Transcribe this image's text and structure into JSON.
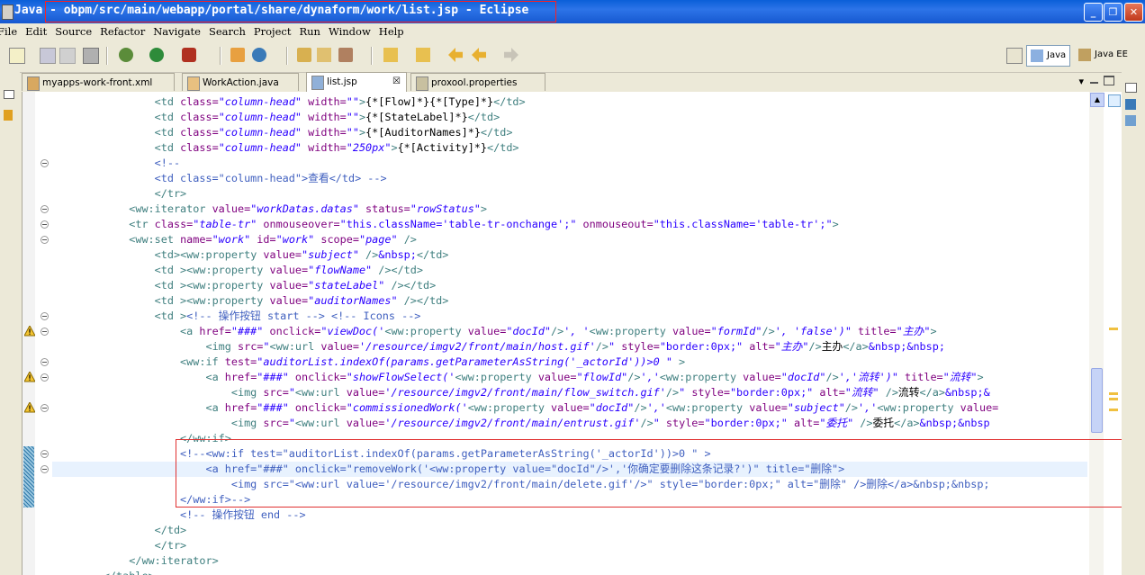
{
  "window": {
    "perspective_label": "Java",
    "title": "- obpm/src/main/webapp/portal/share/dynaform/work/list.jsp - Eclipse",
    "minimize": "_",
    "maximize": "❐",
    "close": "✕"
  },
  "menu": [
    "File",
    "Edit",
    "Source",
    "Refactor",
    "Navigate",
    "Search",
    "Project",
    "Run",
    "Window",
    "Help"
  ],
  "perspectives": [
    {
      "label": "Java",
      "active": true
    },
    {
      "label": "Java EE",
      "active": false
    }
  ],
  "tabs": [
    {
      "label": "myapps-work-front.xml",
      "icon": "xml-file-icon"
    },
    {
      "label": "WorkAction.java",
      "icon": "java-file-icon"
    },
    {
      "label": "list.jsp",
      "icon": "jsp-file-icon",
      "active": true,
      "close": "☒"
    },
    {
      "label": "proxool.properties",
      "icon": "properties-file-icon"
    }
  ],
  "code_lines": [
    [
      [
        "                ",
        ""
      ],
      [
        "<td ",
        "tag"
      ],
      [
        "class=",
        "attr"
      ],
      [
        "\"column-head\"",
        "str"
      ],
      [
        " width=",
        "attr"
      ],
      [
        "\"\"",
        "str"
      ],
      [
        ">",
        "tag"
      ],
      [
        "{*[Flow]*}{*[Type]*}",
        "txt"
      ],
      [
        "</td>",
        "tag"
      ]
    ],
    [
      [
        "                ",
        ""
      ],
      [
        "<td ",
        "tag"
      ],
      [
        "class=",
        "attr"
      ],
      [
        "\"column-head\"",
        "str"
      ],
      [
        " width=",
        "attr"
      ],
      [
        "\"\"",
        "str"
      ],
      [
        ">",
        "tag"
      ],
      [
        "{*[StateLabel]*}",
        "txt"
      ],
      [
        "</td>",
        "tag"
      ]
    ],
    [
      [
        "                ",
        ""
      ],
      [
        "<td ",
        "tag"
      ],
      [
        "class=",
        "attr"
      ],
      [
        "\"column-head\"",
        "str"
      ],
      [
        " width=",
        "attr"
      ],
      [
        "\"\"",
        "str"
      ],
      [
        ">",
        "tag"
      ],
      [
        "{*[AuditorNames]*}",
        "txt"
      ],
      [
        "</td>",
        "tag"
      ]
    ],
    [
      [
        "                ",
        ""
      ],
      [
        "<td ",
        "tag"
      ],
      [
        "class=",
        "attr"
      ],
      [
        "\"column-head\"",
        "str"
      ],
      [
        " width=",
        "attr"
      ],
      [
        "\"250px\"",
        "str"
      ],
      [
        ">",
        "tag"
      ],
      [
        "{*[Activity]*}",
        "txt"
      ],
      [
        "</td>",
        "tag"
      ]
    ],
    [
      [
        "                ",
        ""
      ],
      [
        "<!--",
        "cmt"
      ]
    ],
    [
      [
        "                ",
        ""
      ],
      [
        "<td class=\"column-head\">查看</td> -->",
        "cmt"
      ]
    ],
    [
      [
        "                ",
        ""
      ],
      [
        "</tr>",
        "tag"
      ]
    ],
    [
      [
        "            ",
        ""
      ],
      [
        "<ww:iterator ",
        "tag"
      ],
      [
        "value=",
        "attr"
      ],
      [
        "\"workDatas.datas\"",
        "str"
      ],
      [
        " status=",
        "attr"
      ],
      [
        "\"rowStatus\"",
        "str"
      ],
      [
        ">",
        "tag"
      ]
    ],
    [
      [
        "            ",
        ""
      ],
      [
        "<tr ",
        "tag"
      ],
      [
        "class=",
        "attr"
      ],
      [
        "\"table-tr\"",
        "str"
      ],
      [
        " onmouseover=",
        "attr"
      ],
      [
        "\"this.className='table-tr-onchange';\"",
        "ent"
      ],
      [
        " onmouseout=",
        "attr"
      ],
      [
        "\"this.className='table-tr';\"",
        "ent"
      ],
      [
        ">",
        "tag"
      ]
    ],
    [
      [
        "            ",
        ""
      ],
      [
        "<ww:set ",
        "tag"
      ],
      [
        "name=",
        "attr"
      ],
      [
        "\"work\"",
        "str"
      ],
      [
        " id=",
        "attr"
      ],
      [
        "\"work\"",
        "str"
      ],
      [
        " scope=",
        "attr"
      ],
      [
        "\"page\"",
        "str"
      ],
      [
        " />",
        "tag"
      ]
    ],
    [
      [
        "                ",
        ""
      ],
      [
        "<td>",
        "tag"
      ],
      [
        "<ww:property ",
        "tag"
      ],
      [
        "value=",
        "attr"
      ],
      [
        "\"subject\"",
        "str"
      ],
      [
        " />",
        "tag"
      ],
      [
        "&nbsp;",
        "ent"
      ],
      [
        "</td>",
        "tag"
      ]
    ],
    [
      [
        "                ",
        ""
      ],
      [
        "<td >",
        "tag"
      ],
      [
        "<ww:property ",
        "tag"
      ],
      [
        "value=",
        "attr"
      ],
      [
        "\"flowName\"",
        "str"
      ],
      [
        " />",
        "tag"
      ],
      [
        "</td>",
        "tag"
      ]
    ],
    [
      [
        "                ",
        ""
      ],
      [
        "<td >",
        "tag"
      ],
      [
        "<ww:property ",
        "tag"
      ],
      [
        "value=",
        "attr"
      ],
      [
        "\"stateLabel\"",
        "str"
      ],
      [
        " />",
        "tag"
      ],
      [
        "</td>",
        "tag"
      ]
    ],
    [
      [
        "                ",
        ""
      ],
      [
        "<td >",
        "tag"
      ],
      [
        "<ww:property ",
        "tag"
      ],
      [
        "value=",
        "attr"
      ],
      [
        "\"auditorNames\"",
        "str"
      ],
      [
        " />",
        "tag"
      ],
      [
        "</td>",
        "tag"
      ]
    ],
    [
      [
        "                ",
        ""
      ],
      [
        "<td >",
        "tag"
      ],
      [
        "<!-- 操作按钮 start --> <!-- Icons -->",
        "cmt"
      ]
    ],
    [
      [
        "                    ",
        ""
      ],
      [
        "<a ",
        "tag"
      ],
      [
        "href=",
        "attr"
      ],
      [
        "\"###\"",
        "str"
      ],
      [
        " onclick=",
        "attr"
      ],
      [
        "\"viewDoc('",
        "str"
      ],
      [
        "<ww:property ",
        "tag"
      ],
      [
        "value=",
        "attr"
      ],
      [
        "\"docId\"",
        "str"
      ],
      [
        "/>",
        "tag"
      ],
      [
        "', '",
        "str"
      ],
      [
        "<ww:property ",
        "tag"
      ],
      [
        "value=",
        "attr"
      ],
      [
        "\"formId\"",
        "str"
      ],
      [
        "/>",
        "tag"
      ],
      [
        "', 'false')\"",
        "str"
      ],
      [
        " title=",
        "attr"
      ],
      [
        "\"主办\"",
        "str"
      ],
      [
        ">",
        "tag"
      ]
    ],
    [
      [
        "                        ",
        ""
      ],
      [
        "<img ",
        "tag"
      ],
      [
        "src=",
        "attr"
      ],
      [
        "\"",
        "str"
      ],
      [
        "<ww:url ",
        "tag"
      ],
      [
        "value=",
        "attr"
      ],
      [
        "'/resource/imgv2/front/main/host.gif'",
        "str"
      ],
      [
        "/>",
        "tag"
      ],
      [
        "\"",
        "str"
      ],
      [
        " style=",
        "attr"
      ],
      [
        "\"border:0px;\"",
        "ent"
      ],
      [
        " alt=",
        "attr"
      ],
      [
        "\"主办\"",
        "str"
      ],
      [
        "/>",
        "tag"
      ],
      [
        "主办",
        "txt"
      ],
      [
        "</a>",
        "tag"
      ],
      [
        "&nbsp;&nbsp;",
        "ent"
      ]
    ],
    [
      [
        "                    ",
        ""
      ],
      [
        "<ww:if ",
        "tag"
      ],
      [
        "test=",
        "attr"
      ],
      [
        "\"auditorList.indexOf(params.getParameterAsString('_actorId'))>0 \"",
        "str"
      ],
      [
        " >",
        "tag"
      ]
    ],
    [
      [
        "                        ",
        ""
      ],
      [
        "<a ",
        "tag"
      ],
      [
        "href=",
        "attr"
      ],
      [
        "\"###\"",
        "str"
      ],
      [
        " onclick=",
        "attr"
      ],
      [
        "\"showFlowSelect('",
        "str"
      ],
      [
        "<ww:property ",
        "tag"
      ],
      [
        "value=",
        "attr"
      ],
      [
        "\"flowId\"",
        "str"
      ],
      [
        "/>",
        "tag"
      ],
      [
        "','",
        "str"
      ],
      [
        "<ww:property ",
        "tag"
      ],
      [
        "value=",
        "attr"
      ],
      [
        "\"docId\"",
        "str"
      ],
      [
        "/>",
        "tag"
      ],
      [
        "','流转')\"",
        "str"
      ],
      [
        " title=",
        "attr"
      ],
      [
        "\"流转\"",
        "str"
      ],
      [
        ">",
        "tag"
      ]
    ],
    [
      [
        "                            ",
        ""
      ],
      [
        "<img ",
        "tag"
      ],
      [
        "src=",
        "attr"
      ],
      [
        "\"",
        "str"
      ],
      [
        "<ww:url ",
        "tag"
      ],
      [
        "value=",
        "attr"
      ],
      [
        "'/resource/imgv2/front/main/flow_switch.gif'",
        "str"
      ],
      [
        "/>",
        "tag"
      ],
      [
        "\"",
        "str"
      ],
      [
        " style=",
        "attr"
      ],
      [
        "\"border:0px;\"",
        "ent"
      ],
      [
        " alt=",
        "attr"
      ],
      [
        "\"流转\"",
        "str"
      ],
      [
        " />",
        "tag"
      ],
      [
        "流转",
        "txt"
      ],
      [
        "</a>",
        "tag"
      ],
      [
        "&nbsp;&",
        "ent"
      ]
    ],
    [
      [
        "                        ",
        ""
      ],
      [
        "<a ",
        "tag"
      ],
      [
        "href=",
        "attr"
      ],
      [
        "\"###\"",
        "str"
      ],
      [
        " onclick=",
        "attr"
      ],
      [
        "\"commissionedWork('",
        "str"
      ],
      [
        "<ww:property ",
        "tag"
      ],
      [
        "value=",
        "attr"
      ],
      [
        "\"docId\"",
        "str"
      ],
      [
        "/>",
        "tag"
      ],
      [
        "','",
        "str"
      ],
      [
        "<ww:property ",
        "tag"
      ],
      [
        "value=",
        "attr"
      ],
      [
        "\"subject\"",
        "str"
      ],
      [
        "/>",
        "tag"
      ],
      [
        "','",
        "str"
      ],
      [
        "<ww:property ",
        "tag"
      ],
      [
        "value=",
        "attr"
      ]
    ],
    [
      [
        "                            ",
        ""
      ],
      [
        "<img ",
        "tag"
      ],
      [
        "src=",
        "attr"
      ],
      [
        "\"",
        "str"
      ],
      [
        "<ww:url ",
        "tag"
      ],
      [
        "value=",
        "attr"
      ],
      [
        "'/resource/imgv2/front/main/entrust.gif'",
        "str"
      ],
      [
        "/>",
        "tag"
      ],
      [
        "\"",
        "str"
      ],
      [
        " style=",
        "attr"
      ],
      [
        "\"border:0px;\"",
        "ent"
      ],
      [
        " alt=",
        "attr"
      ],
      [
        "\"委托\"",
        "str"
      ],
      [
        " />",
        "tag"
      ],
      [
        "委托",
        "txt"
      ],
      [
        "</a>",
        "tag"
      ],
      [
        "&nbsp;&nbsp",
        "ent"
      ]
    ],
    [
      [
        "                    ",
        ""
      ],
      [
        "</ww:if>",
        "tag"
      ]
    ],
    [
      [
        "                    ",
        ""
      ],
      [
        "<!--<ww:if test=\"auditorList.indexOf(params.getParameterAsString('_actorId'))>0 \" >",
        "cmt"
      ]
    ],
    [
      [
        "                        ",
        ""
      ],
      [
        "<a href=\"###\" onclick=\"removeWork('<ww:property value=\"docId\"/>','你确定要删除这条记录?')\" title=\"删除\">",
        "cmt"
      ]
    ],
    [
      [
        "                            ",
        ""
      ],
      [
        "<img src=\"<ww:url value='/resource/imgv2/front/main/delete.gif'/>\" style=\"border:0px;\" alt=\"删除\" />删除</a>&nbsp;&nbsp;",
        "cmt"
      ]
    ],
    [
      [
        "                    ",
        ""
      ],
      [
        "</ww:if>-->",
        "cmt"
      ]
    ],
    [
      [
        "                    ",
        ""
      ],
      [
        "<!-- 操作按钮 end -->",
        "cmt"
      ]
    ],
    [
      [
        "                ",
        ""
      ],
      [
        "</td>",
        "tag"
      ]
    ],
    [
      [
        "                ",
        ""
      ],
      [
        "</tr>",
        "tag"
      ]
    ],
    [
      [
        "            ",
        ""
      ],
      [
        "</ww:iterator>",
        "tag"
      ]
    ],
    [
      [
        "        ",
        ""
      ],
      [
        "</table>",
        "tag"
      ]
    ]
  ],
  "current_line": 24,
  "warning_lines": [
    15,
    18,
    20
  ],
  "fold_lines": [
    4,
    7,
    8,
    9,
    14,
    15,
    17,
    18,
    20,
    23,
    24
  ],
  "quick_diff_lines": [
    23,
    24,
    25,
    26
  ]
}
